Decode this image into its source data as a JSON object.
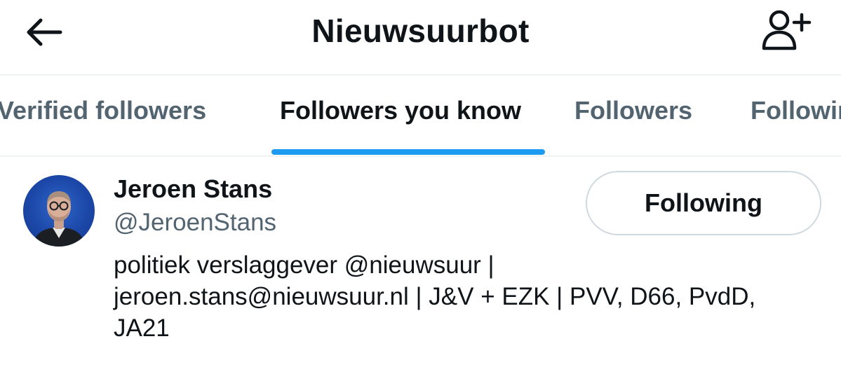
{
  "header": {
    "title": "Nieuwsuurbot",
    "back_icon": "arrow-left-icon",
    "add_icon": "person-plus-icon"
  },
  "tabs": [
    {
      "label": "Verified followers",
      "active": false
    },
    {
      "label": "Followers you know",
      "active": true
    },
    {
      "label": "Followers",
      "active": false
    },
    {
      "label": "Following",
      "active": false
    }
  ],
  "colors": {
    "accent": "#1d9bf0",
    "text_primary": "#0f1419",
    "text_secondary": "#536471",
    "border": "#cfd9de"
  },
  "user": {
    "name": "Jeroen Stans",
    "handle": "@JeroenStans",
    "follow_button": "Following",
    "bio_lines": [
      "politiek verslaggever @nieuwsuur |",
      "jeroen.stans@nieuwsuur.nl | J&V + EZK | PVV, D66, PvdD,",
      "JA21"
    ]
  }
}
